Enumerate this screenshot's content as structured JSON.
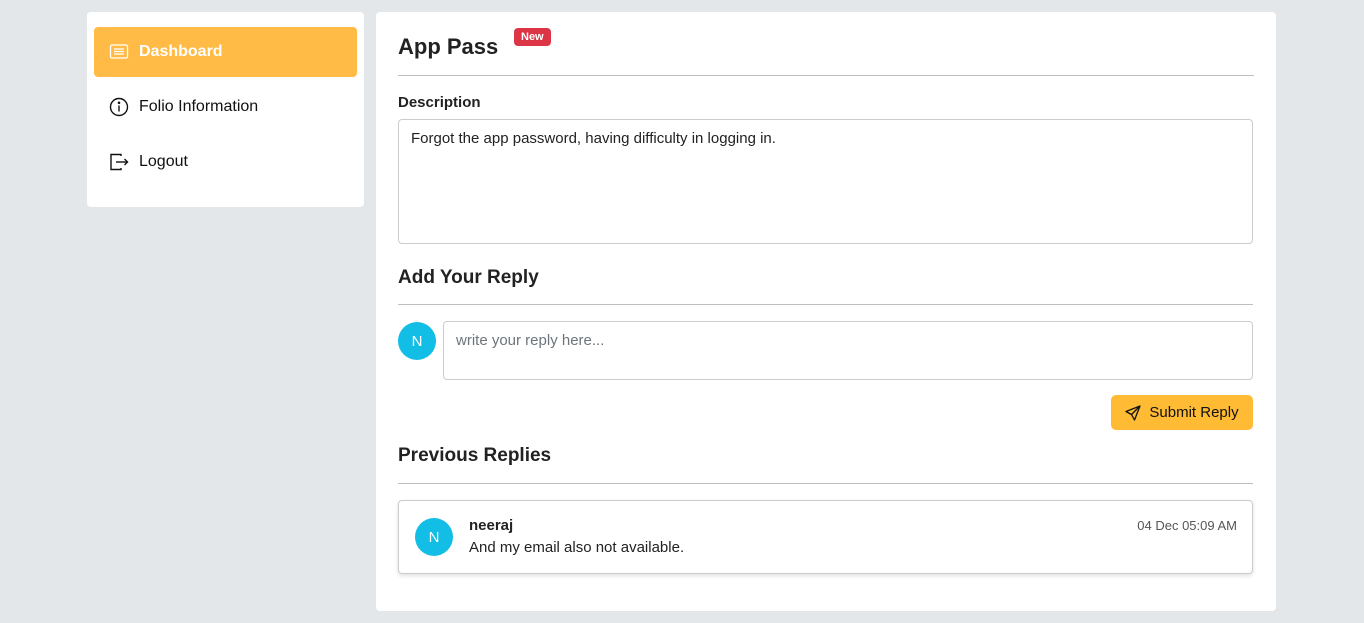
{
  "sidebar": {
    "items": [
      {
        "label": "Dashboard",
        "icon": "list-icon",
        "active": true
      },
      {
        "label": "Folio Information",
        "icon": "info-icon",
        "active": false
      },
      {
        "label": "Logout",
        "icon": "logout-icon",
        "active": false
      }
    ]
  },
  "ticket": {
    "title": "App Pass",
    "badge": "New",
    "description_label": "Description",
    "description": "Forgot the app password, having difficulty in logging in."
  },
  "reply_form": {
    "heading": "Add Your Reply",
    "avatar_initial": "N",
    "placeholder": "write your reply here...",
    "submit_label": "Submit Reply"
  },
  "previous_replies": {
    "heading": "Previous Replies",
    "items": [
      {
        "avatar_initial": "N",
        "author": "neeraj",
        "text": "And my email also not available.",
        "time": "04 Dec 05:09 AM"
      }
    ]
  },
  "colors": {
    "accent": "#ffbb45",
    "badge": "#dc3545",
    "avatar": "#12bde6",
    "background": "#e4e7ea"
  }
}
